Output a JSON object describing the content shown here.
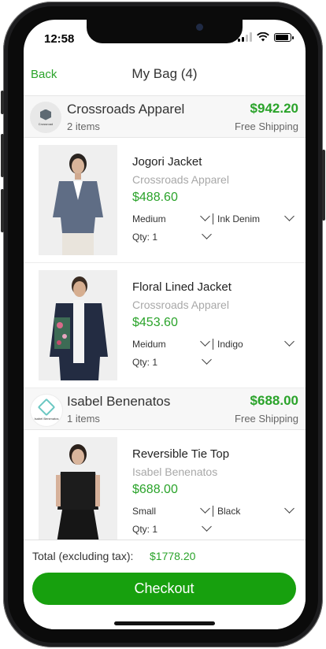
{
  "status": {
    "time": "12:58"
  },
  "nav": {
    "back_label": "Back",
    "title": "My Bag (4)"
  },
  "stores": [
    {
      "name": "Crossroads Apparel",
      "logo_text": "Crossroad",
      "count": "2 items",
      "total": "$942.20",
      "shipping": "Free Shipping",
      "items": [
        {
          "title": "Jogori Jacket",
          "brand": "Crossroads Apparel",
          "price": "$488.60",
          "size": "Medium",
          "color": "Ink Denim",
          "qty": "Qty: 1"
        },
        {
          "title": "Floral Lined Jacket",
          "brand": "Crossroads Apparel",
          "price": "$453.60",
          "size": "Meidum",
          "color": "Indigo",
          "qty": "Qty: 1"
        }
      ]
    },
    {
      "name": "Isabel Benenatos",
      "logo_text": "Isabel Benenatos",
      "count": "1 items",
      "total": "$688.00",
      "shipping": "Free Shipping",
      "items": [
        {
          "title": "Reversible Tie Top",
          "brand": "Isabel Benenatos",
          "price": "$688.00",
          "size": "Small",
          "color": "Black",
          "qty": "Qty: 1"
        }
      ]
    }
  ],
  "footer": {
    "total_label": "Total (excluding tax):",
    "total_value": "$1778.20",
    "checkout_label": "Checkout"
  },
  "colors": {
    "accent": "#2aa32a",
    "button": "#17a00e",
    "muted": "#a8a8a8"
  },
  "icons": [
    "signal-icon",
    "wifi-icon",
    "battery-icon",
    "chevron-down-icon"
  ]
}
